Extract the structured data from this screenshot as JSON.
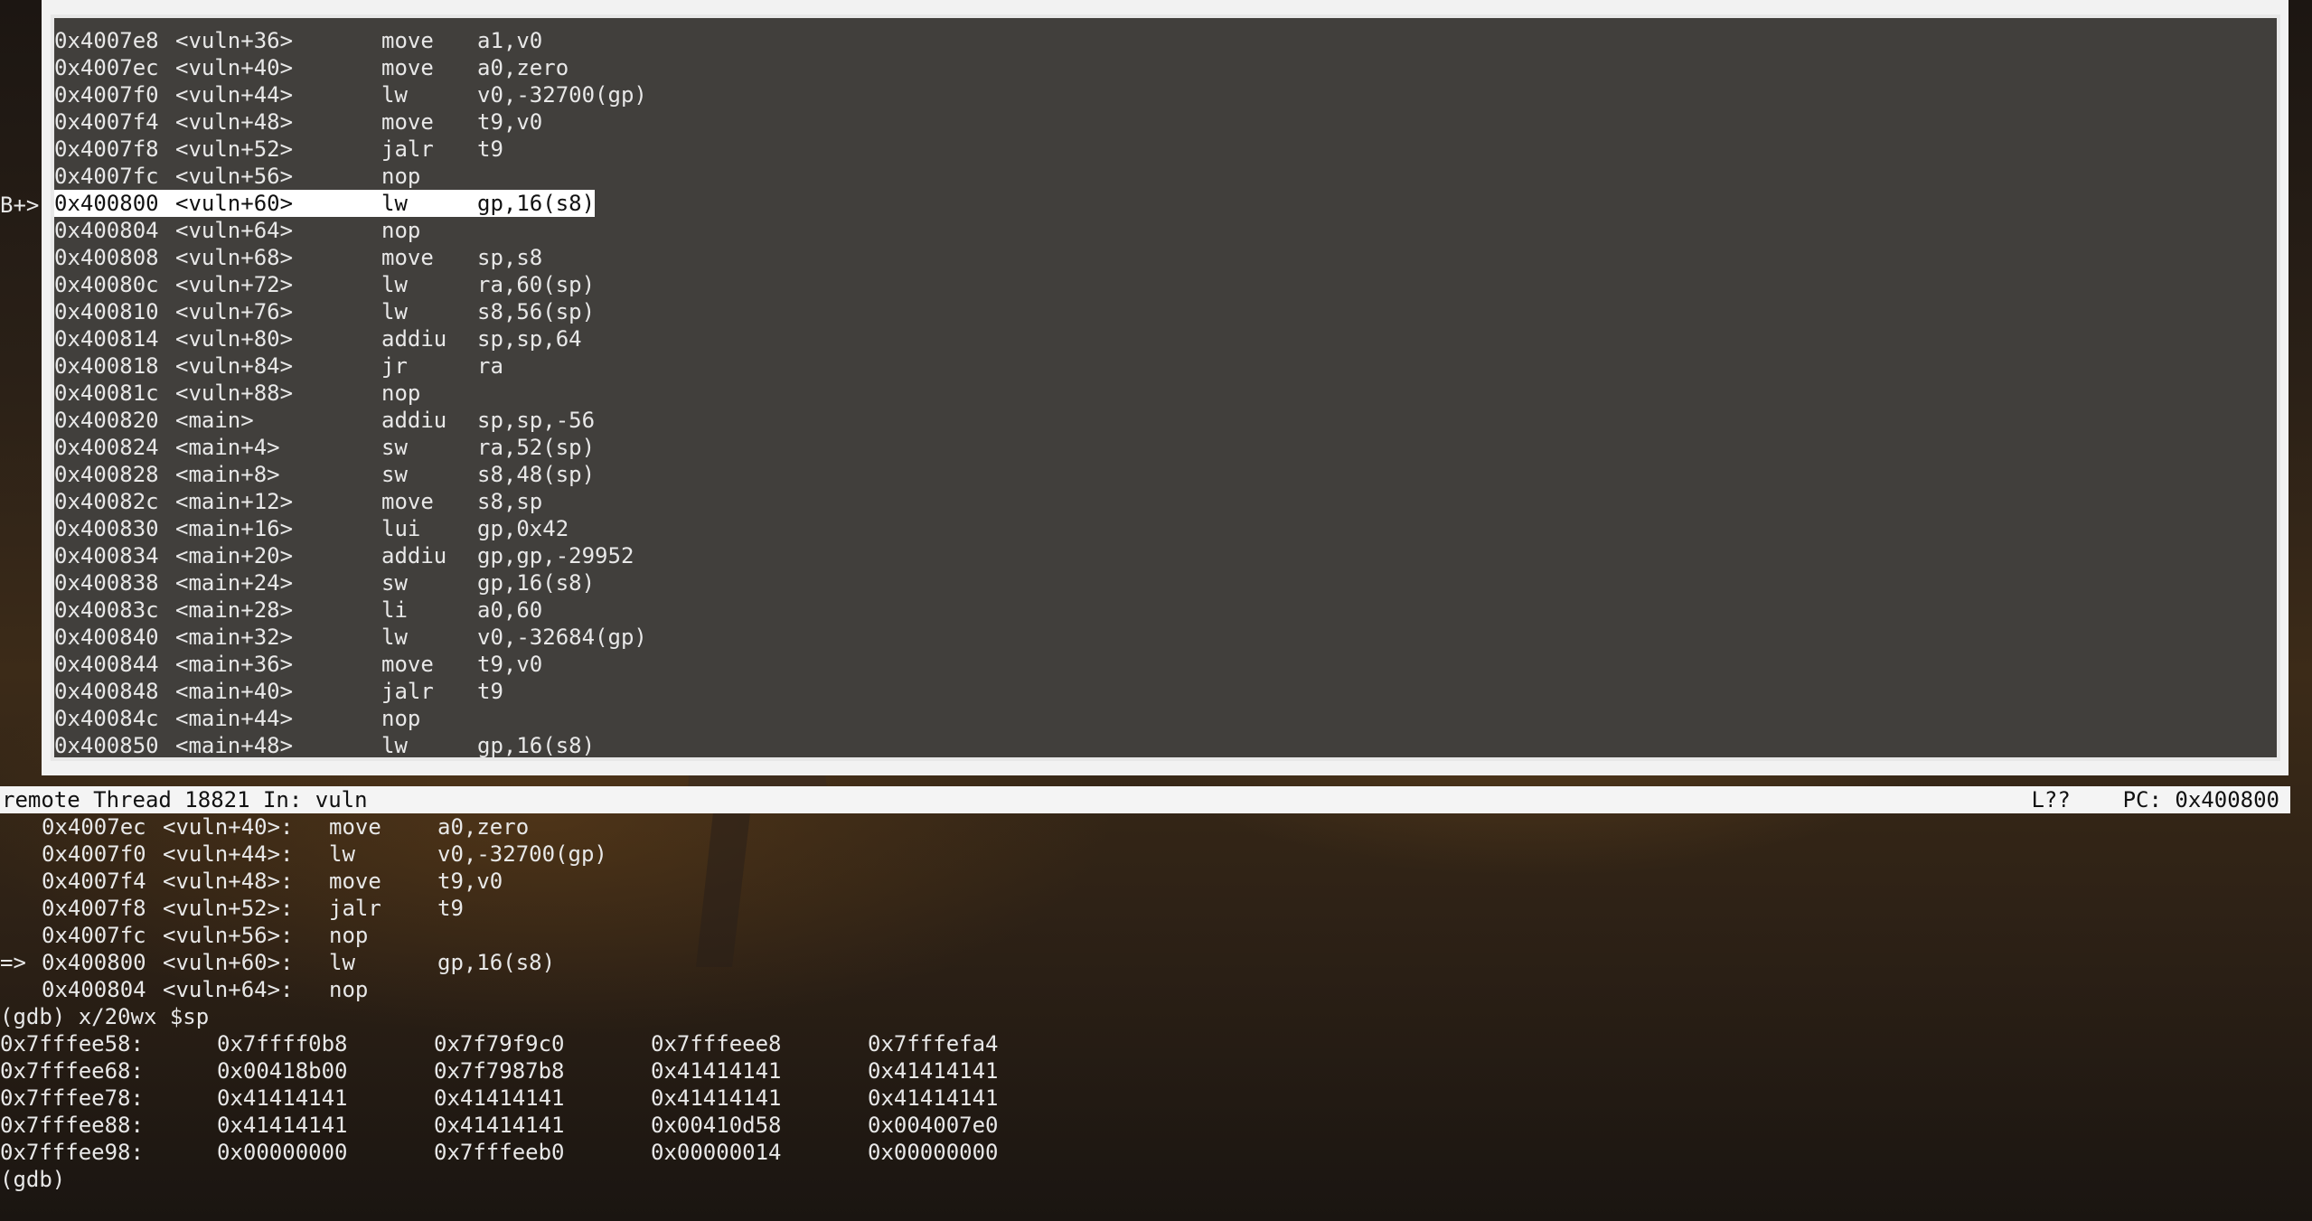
{
  "tui": {
    "gutter_marker": "B+>",
    "asm_lines": [
      {
        "addr": "0x4007e8",
        "sym": "<vuln+36>",
        "op": "move",
        "args": "a1,v0",
        "highlighted": false
      },
      {
        "addr": "0x4007ec",
        "sym": "<vuln+40>",
        "op": "move",
        "args": "a0,zero",
        "highlighted": false
      },
      {
        "addr": "0x4007f0",
        "sym": "<vuln+44>",
        "op": "lw",
        "args": "v0,-32700(gp)",
        "highlighted": false
      },
      {
        "addr": "0x4007f4",
        "sym": "<vuln+48>",
        "op": "move",
        "args": "t9,v0",
        "highlighted": false
      },
      {
        "addr": "0x4007f8",
        "sym": "<vuln+52>",
        "op": "jalr",
        "args": "t9",
        "highlighted": false
      },
      {
        "addr": "0x4007fc",
        "sym": "<vuln+56>",
        "op": "nop",
        "args": "",
        "highlighted": false
      },
      {
        "addr": "0x400800",
        "sym": "<vuln+60>",
        "op": "lw",
        "args": "gp,16(s8)",
        "highlighted": true
      },
      {
        "addr": "0x400804",
        "sym": "<vuln+64>",
        "op": "nop",
        "args": "",
        "highlighted": false
      },
      {
        "addr": "0x400808",
        "sym": "<vuln+68>",
        "op": "move",
        "args": "sp,s8",
        "highlighted": false
      },
      {
        "addr": "0x40080c",
        "sym": "<vuln+72>",
        "op": "lw",
        "args": "ra,60(sp)",
        "highlighted": false
      },
      {
        "addr": "0x400810",
        "sym": "<vuln+76>",
        "op": "lw",
        "args": "s8,56(sp)",
        "highlighted": false
      },
      {
        "addr": "0x400814",
        "sym": "<vuln+80>",
        "op": "addiu",
        "args": "sp,sp,64",
        "highlighted": false
      },
      {
        "addr": "0x400818",
        "sym": "<vuln+84>",
        "op": "jr",
        "args": "ra",
        "highlighted": false
      },
      {
        "addr": "0x40081c",
        "sym": "<vuln+88>",
        "op": "nop",
        "args": "",
        "highlighted": false
      },
      {
        "addr": "0x400820",
        "sym": "<main>",
        "op": "addiu",
        "args": "sp,sp,-56",
        "highlighted": false
      },
      {
        "addr": "0x400824",
        "sym": "<main+4>",
        "op": "sw",
        "args": "ra,52(sp)",
        "highlighted": false
      },
      {
        "addr": "0x400828",
        "sym": "<main+8>",
        "op": "sw",
        "args": "s8,48(sp)",
        "highlighted": false
      },
      {
        "addr": "0x40082c",
        "sym": "<main+12>",
        "op": "move",
        "args": "s8,sp",
        "highlighted": false
      },
      {
        "addr": "0x400830",
        "sym": "<main+16>",
        "op": "lui",
        "args": "gp,0x42",
        "highlighted": false
      },
      {
        "addr": "0x400834",
        "sym": "<main+20>",
        "op": "addiu",
        "args": "gp,gp,-29952",
        "highlighted": false
      },
      {
        "addr": "0x400838",
        "sym": "<main+24>",
        "op": "sw",
        "args": "gp,16(s8)",
        "highlighted": false
      },
      {
        "addr": "0x40083c",
        "sym": "<main+28>",
        "op": "li",
        "args": "a0,60",
        "highlighted": false
      },
      {
        "addr": "0x400840",
        "sym": "<main+32>",
        "op": "lw",
        "args": "v0,-32684(gp)",
        "highlighted": false
      },
      {
        "addr": "0x400844",
        "sym": "<main+36>",
        "op": "move",
        "args": "t9,v0",
        "highlighted": false
      },
      {
        "addr": "0x400848",
        "sym": "<main+40>",
        "op": "jalr",
        "args": "t9",
        "highlighted": false
      },
      {
        "addr": "0x40084c",
        "sym": "<main+44>",
        "op": "nop",
        "args": "",
        "highlighted": false
      },
      {
        "addr": "0x400850",
        "sym": "<main+48>",
        "op": "lw",
        "args": "gp,16(s8)",
        "highlighted": false
      }
    ]
  },
  "status": {
    "left": "remote Thread 18821 In: vuln",
    "line": "L??",
    "pc": "PC: 0x400800"
  },
  "console": {
    "disasm": [
      {
        "arrow": "",
        "addr": "0x4007ec",
        "sym": "<vuln+40>:",
        "op": "move",
        "args": "a0,zero"
      },
      {
        "arrow": "",
        "addr": "0x4007f0",
        "sym": "<vuln+44>:",
        "op": "lw",
        "args": "v0,-32700(gp)"
      },
      {
        "arrow": "",
        "addr": "0x4007f4",
        "sym": "<vuln+48>:",
        "op": "move",
        "args": "t9,v0"
      },
      {
        "arrow": "",
        "addr": "0x4007f8",
        "sym": "<vuln+52>:",
        "op": "jalr",
        "args": "t9"
      },
      {
        "arrow": "",
        "addr": "0x4007fc",
        "sym": "<vuln+56>:",
        "op": "nop",
        "args": ""
      },
      {
        "arrow": "=>",
        "addr": "0x400800",
        "sym": "<vuln+60>:",
        "op": "lw",
        "args": "gp,16(s8)"
      },
      {
        "arrow": "",
        "addr": "0x400804",
        "sym": "<vuln+64>:",
        "op": "nop",
        "args": ""
      }
    ],
    "command": "(gdb) x/20wx $sp",
    "memory": [
      {
        "addr": "0x7fffee58:",
        "words": [
          "0x7ffff0b8",
          "0x7f79f9c0",
          "0x7fffeee8",
          "0x7fffefa4"
        ]
      },
      {
        "addr": "0x7fffee68:",
        "words": [
          "0x00418b00",
          "0x7f7987b8",
          "0x41414141",
          "0x41414141"
        ]
      },
      {
        "addr": "0x7fffee78:",
        "words": [
          "0x41414141",
          "0x41414141",
          "0x41414141",
          "0x41414141"
        ]
      },
      {
        "addr": "0x7fffee88:",
        "words": [
          "0x41414141",
          "0x41414141",
          "0x00410d58",
          "0x004007e0"
        ]
      },
      {
        "addr": "0x7fffee98:",
        "words": [
          "0x00000000",
          "0x7fffeeb0",
          "0x00000014",
          "0x00000000"
        ]
      }
    ],
    "prompt": "(gdb)"
  }
}
